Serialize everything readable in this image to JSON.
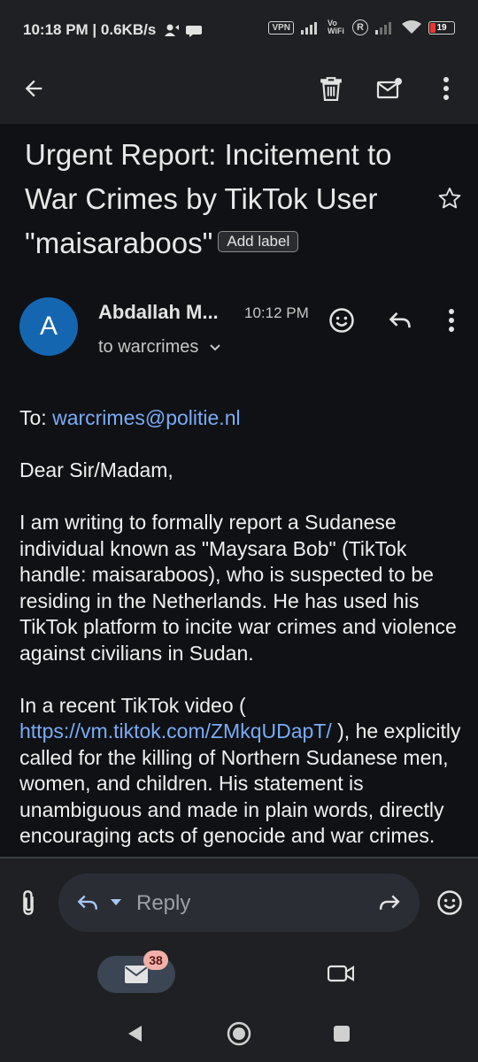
{
  "status_bar": {
    "time": "10:18 PM | 0.6KB/s",
    "vpn": "VPN",
    "vowifi": "Vo WiFi",
    "reg": "R",
    "battery": "19"
  },
  "email": {
    "subject": "Urgent Report: Incitement to War Crimes by TikTok User \"maisaraboos\"",
    "label_chip": "Add label",
    "sender_initial": "A",
    "sender_name": "Abdallah M...",
    "time": "10:12 PM",
    "recipient": "to warcrimes",
    "body": {
      "to_prefix": "To: ",
      "to_email": "warcrimes@politie.nl",
      "greeting": "Dear Sir/Madam,",
      "para1": "I am writing to formally report a Sudanese individual known as \"Maysara Bob\" (TikTok handle: maisaraboos), who is suspected to be residing in the Netherlands. He has used his TikTok platform to incite war crimes and violence against civilians in Sudan.",
      "para2_prefix": "In a recent TikTok video (",
      "para2_link": "https://vm.tiktok.com/ZMkqUDapT/",
      "para2_suffix": " ), he explicitly called for the killing of Northern Sudanese men, women, and children. His statement is unambiguous and made in plain words, directly encouraging acts of genocide and war crimes."
    }
  },
  "reply_bar": {
    "reply_label": "Reply"
  },
  "bottom_nav": {
    "mail_badge": "38"
  },
  "colors": {
    "accent": "#7aacf5",
    "avatar": "#1566b0",
    "badge": "#f1b0a9"
  }
}
